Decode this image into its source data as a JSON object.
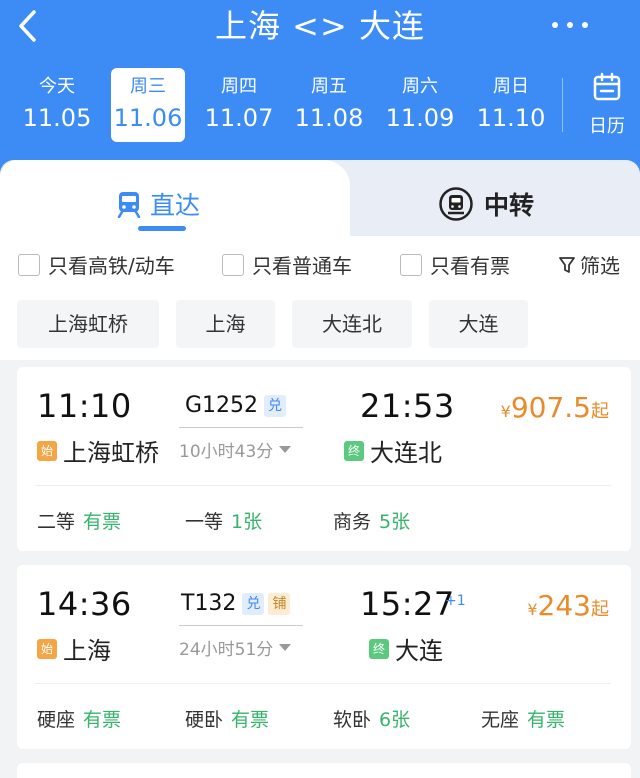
{
  "header": {
    "back_icon": "chevron-left-icon",
    "title": "上海 <> 大连",
    "more_icon": "more-dots-icon"
  },
  "dates": [
    {
      "weekday": "今天",
      "date": "11.05",
      "active": false
    },
    {
      "weekday": "周三",
      "date": "11.06",
      "active": true
    },
    {
      "weekday": "周四",
      "date": "11.07",
      "active": false
    },
    {
      "weekday": "周五",
      "date": "11.08",
      "active": false
    },
    {
      "weekday": "周六",
      "date": "11.09",
      "active": false
    },
    {
      "weekday": "周日",
      "date": "11.10",
      "active": false
    }
  ],
  "calendar": {
    "label": "日历",
    "icon": "calendar-icon"
  },
  "modes": {
    "direct": {
      "label": "直达",
      "icon": "train-icon"
    },
    "transfer": {
      "label": "中转",
      "icon": "transfer-train-icon"
    }
  },
  "filters": {
    "high_speed": "只看高铁/动车",
    "normal": "只看普通车",
    "available": "只看有票",
    "filter_label": "筛选",
    "filter_icon": "funnel-icon"
  },
  "stations": [
    "上海虹桥",
    "上海",
    "大连北",
    "大连"
  ],
  "trains": [
    {
      "dep_time": "11:10",
      "dep_station": "上海虹桥",
      "start_badge": "始",
      "train_no": "G1252",
      "tag_dui": "兑",
      "tag_pu": "",
      "duration": "10小时43分",
      "arr_time": "21:53",
      "arr_plus": "",
      "arr_station": "大连北",
      "end_badge": "终",
      "price_currency": "¥",
      "price": "907.5",
      "price_suffix": "起",
      "seats": [
        {
          "type": "二等",
          "status": "有票"
        },
        {
          "type": "一等",
          "status": "1张"
        },
        {
          "type": "商务",
          "status": "5张"
        }
      ]
    },
    {
      "dep_time": "14:36",
      "dep_station": "上海",
      "start_badge": "始",
      "train_no": "T132",
      "tag_dui": "兑",
      "tag_pu": "铺",
      "duration": "24小时51分",
      "arr_time": "15:27",
      "arr_plus": "+1",
      "arr_station": "大连",
      "end_badge": "终",
      "price_currency": "¥",
      "price": "243",
      "price_suffix": "起",
      "seats": [
        {
          "type": "硬座",
          "status": "有票"
        },
        {
          "type": "硬卧",
          "status": "有票"
        },
        {
          "type": "软卧",
          "status": "6张"
        },
        {
          "type": "无座",
          "status": "有票"
        }
      ]
    }
  ],
  "colors": {
    "brand": "#3d8bf5",
    "price": "#e98b2b",
    "available": "#36b46a"
  }
}
